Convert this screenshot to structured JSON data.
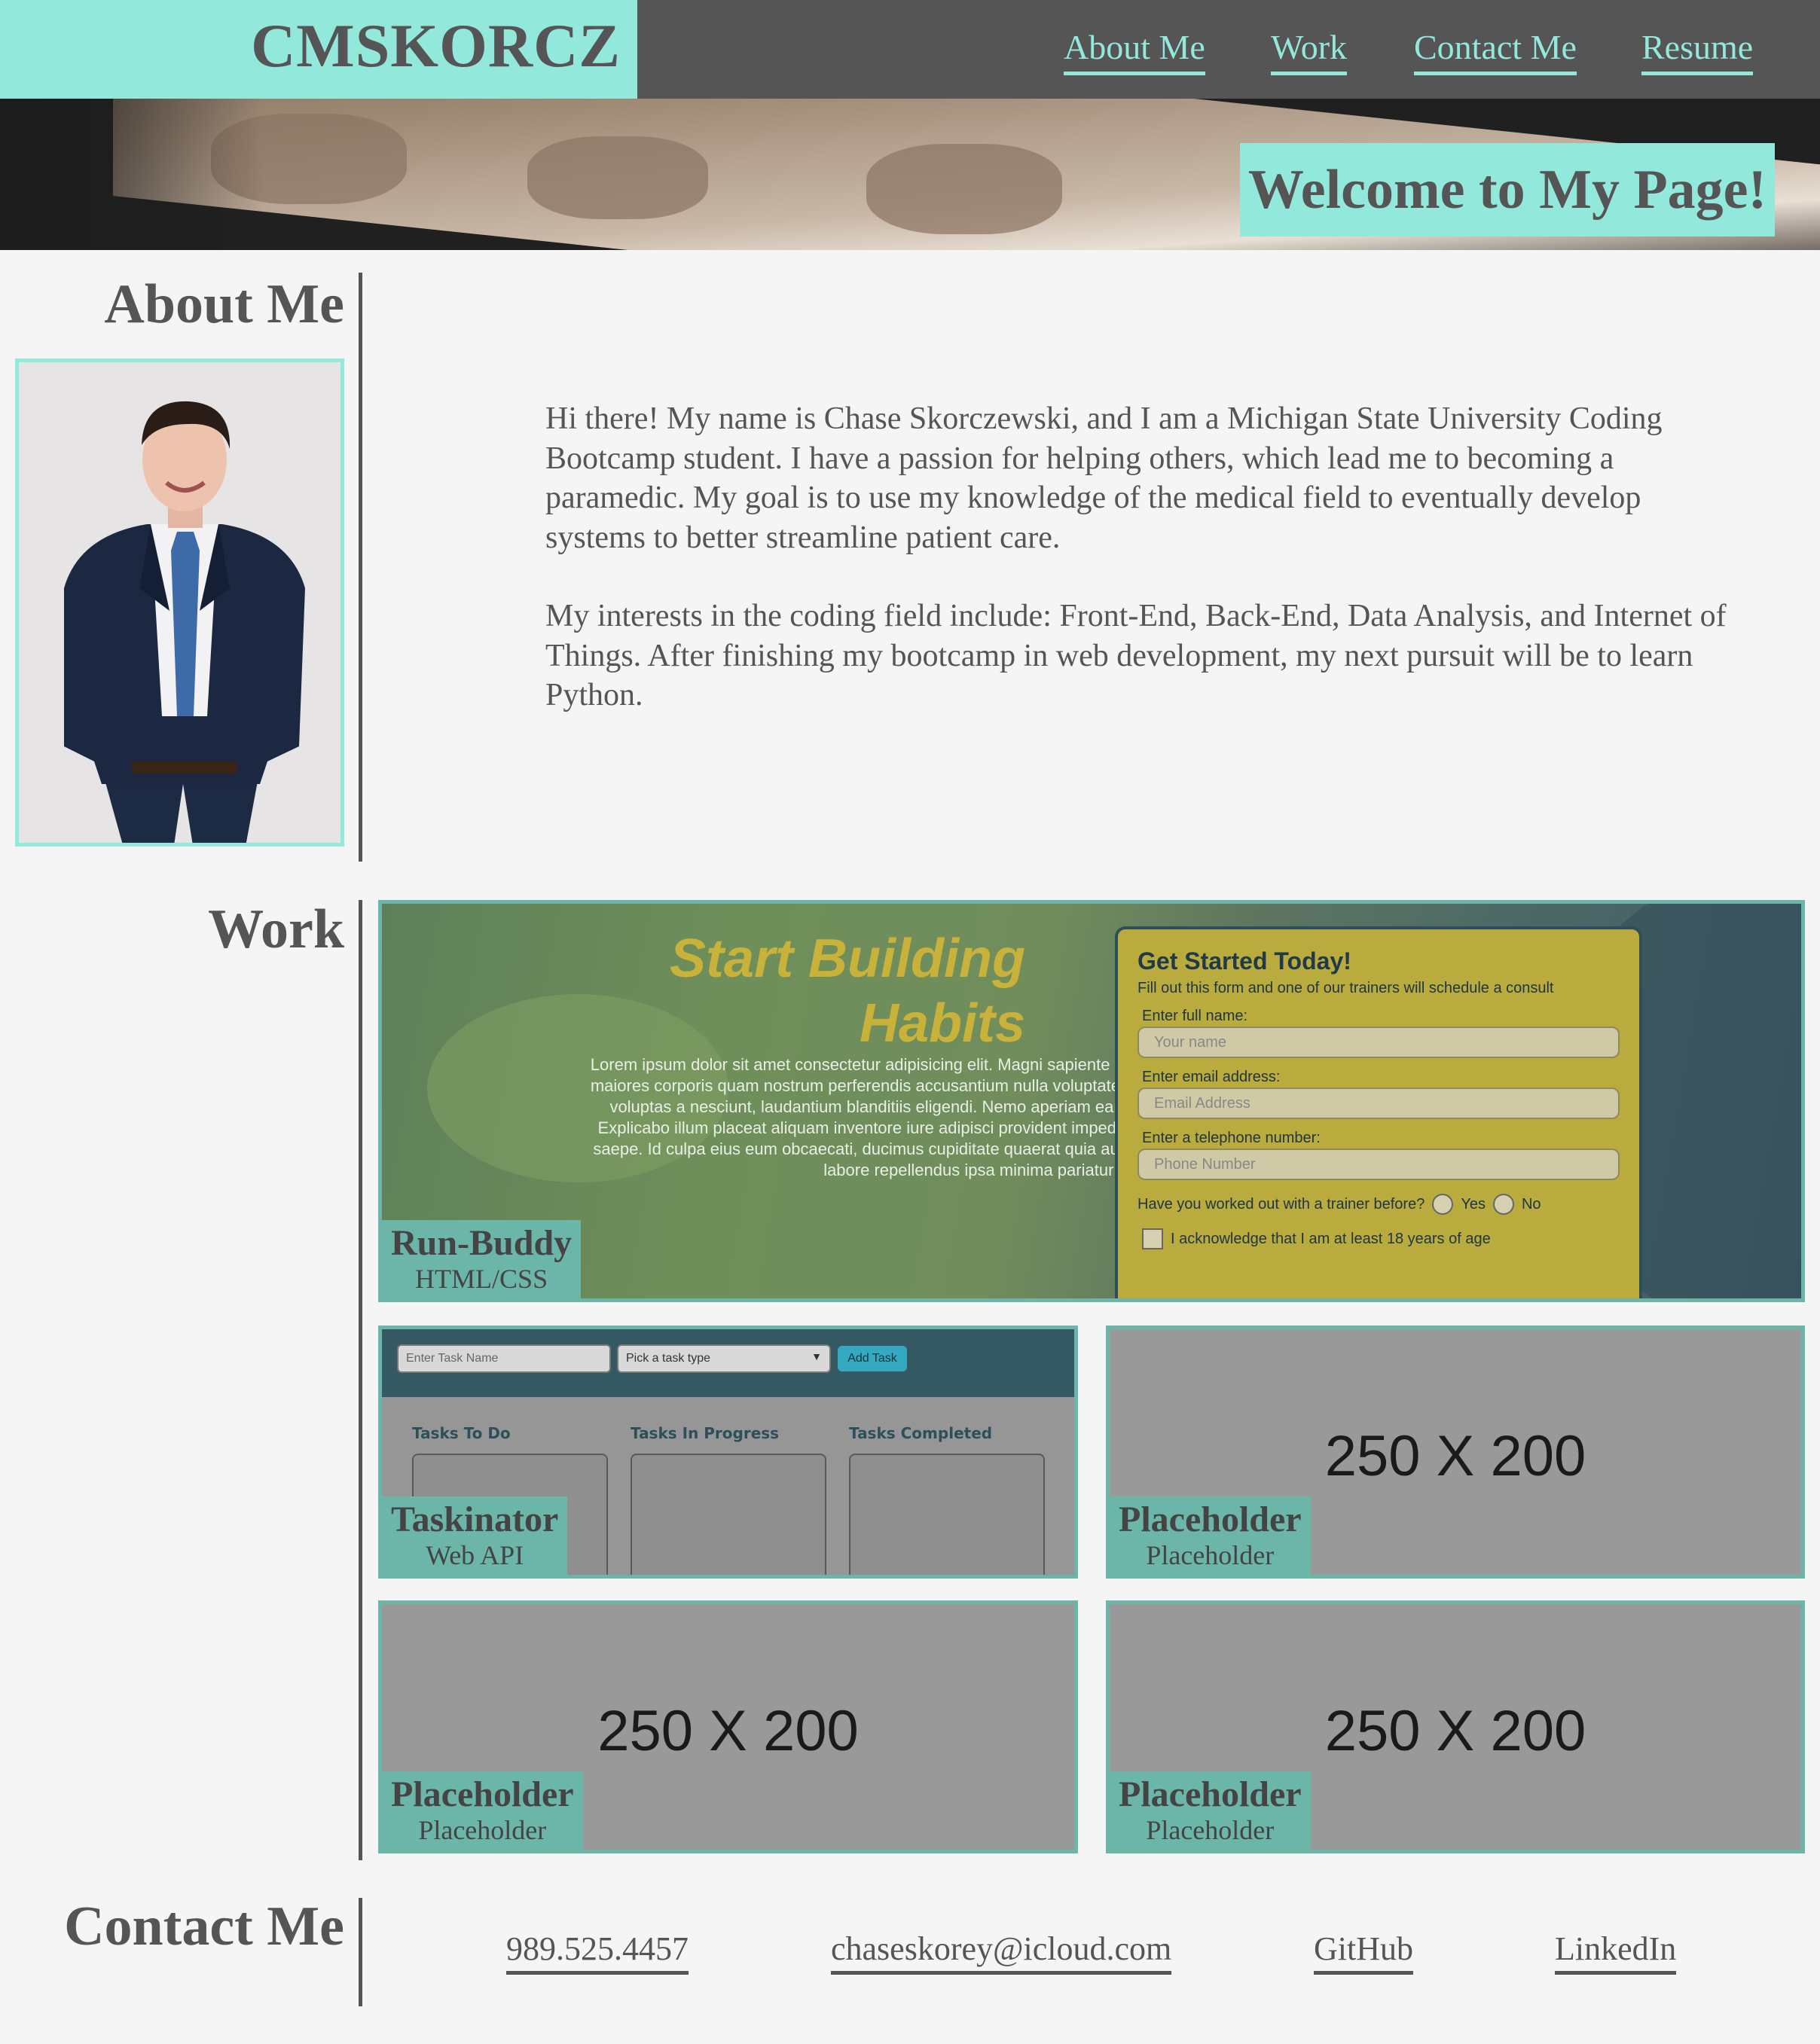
{
  "header": {
    "brand": "CMSKORCZ",
    "nav": [
      "About Me",
      "Work",
      "Contact Me",
      "Resume"
    ]
  },
  "hero": {
    "title": "Welcome to My Page!"
  },
  "about": {
    "title": "About Me",
    "paragraphs": [
      "Hi there! My name is Chase Skorczewski, and I am a Michigan State University Coding Bootcamp student. I have a passion for helping others, which lead me to becoming a paramedic. My goal is to use my knowledge of the medical field to eventually develop systems to better streamline patient care.",
      "My interests in the coding field include: Front-End, Back-End, Data Analysis, and Internet of Things. After finishing my bootcamp in web development, my next pursuit will be to learn Python."
    ]
  },
  "work": {
    "title": "Work",
    "projects": [
      {
        "name": "Run-Buddy",
        "tech": "HTML/CSS"
      },
      {
        "name": "Taskinator",
        "tech": "Web API"
      },
      {
        "name": "Placeholder",
        "tech": "Placeholder"
      },
      {
        "name": "Placeholder",
        "tech": "Placeholder"
      },
      {
        "name": "Placeholder",
        "tech": "Placeholder"
      }
    ],
    "placeholder_image_text": "250 X 200",
    "runbuddy_preview": {
      "headline_1": "Start Building",
      "headline_2": "Habits",
      "lorem": "Lorem ipsum dolor sit amet consectetur adipisicing elit. Magni sapiente voluptatibus maiores corporis quam nostrum perferendis accusantium nulla voluptatem dolorum, voluptas a nesciunt, laudantium blanditiis eligendi. Nemo aperiam earum tenetur! Explicabo illum placeat aliquam inventore iure adipisci provident impedit nemo non saepe. Id culpa eius eum obcaecati, ducimus cupiditate quaerat quia aut explicabo, labore repellendus ipsa minima pariatur illo suscipit!",
      "form_title": "Get Started Today!",
      "form_sub": "Fill out this form and one of our trainers will schedule a consult",
      "name_label": "Enter full name:",
      "name_placeholder": "Your name",
      "email_label": "Enter email address:",
      "email_placeholder": "Email Address",
      "phone_label": "Enter a telephone number:",
      "phone_placeholder": "Phone Number",
      "trainer_question": "Have you worked out with a trainer before?",
      "yes": "Yes",
      "no": "No",
      "age_ack": "I acknowledge that I am at least 18 years of age"
    },
    "taskinator_preview": {
      "task_name_placeholder": "Enter Task Name",
      "task_type_placeholder": "Pick a task type",
      "add_button": "Add Task",
      "columns": [
        "Tasks To Do",
        "Tasks In Progress",
        "Tasks Completed"
      ]
    }
  },
  "contact": {
    "title": "Contact Me",
    "links": [
      "989.525.4457",
      "chaseskorey@icloud.com",
      "GitHub",
      "LinkedIn"
    ]
  },
  "colors": {
    "accent": "#93e8dc",
    "card_border": "#6cb5a9",
    "header_bg": "#555555",
    "text": "#555555",
    "page_bg": "#f5f5f5"
  }
}
